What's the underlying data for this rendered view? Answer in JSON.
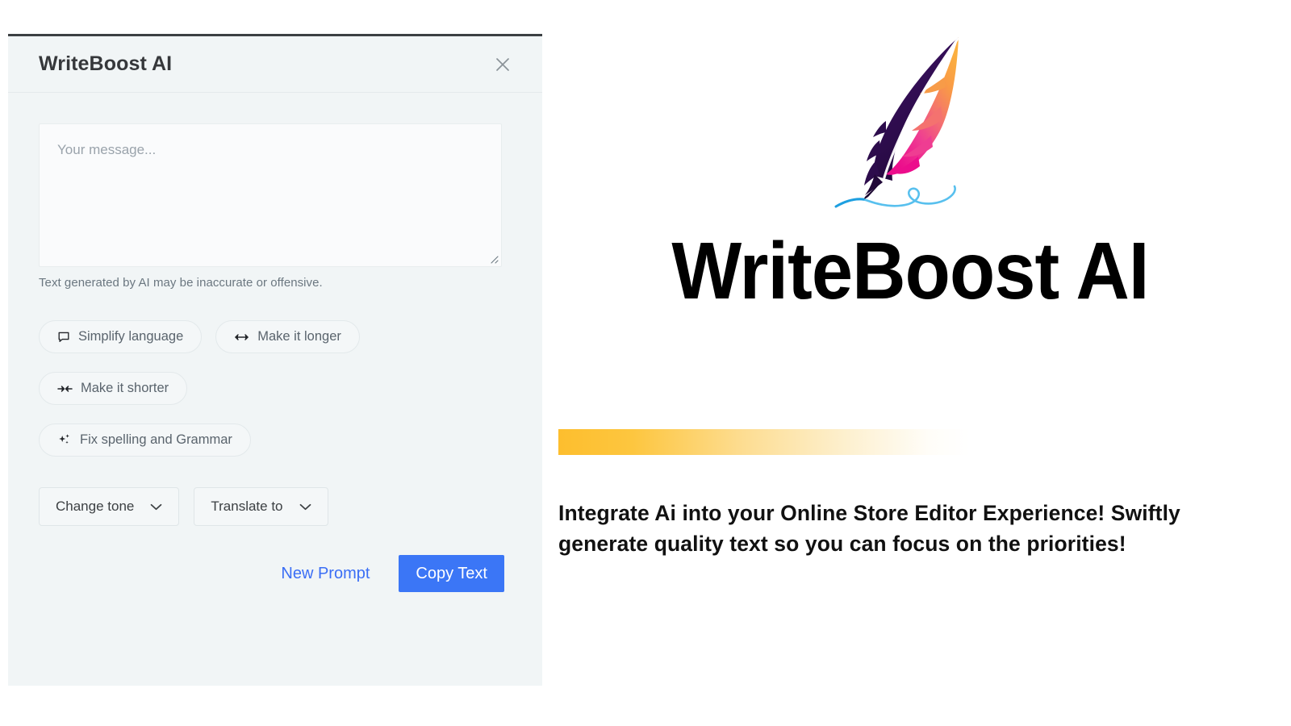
{
  "panel": {
    "title": "WriteBoost AI",
    "close_icon": "close-icon",
    "prompt": {
      "value": "",
      "placeholder": "Your message..."
    },
    "disclaimer": "Text generated by AI may be inaccurate or offensive.",
    "chips": [
      {
        "label": "Simplify language",
        "icon": "speech-bubble-icon"
      },
      {
        "label": "Make it longer",
        "icon": "arrows-expand-icon"
      },
      {
        "label": "Make it shorter",
        "icon": "arrows-collapse-icon"
      },
      {
        "label": "Fix spelling and Grammar",
        "icon": "sparkle-icon"
      }
    ],
    "selects": [
      {
        "label": "Change tone",
        "icon": "chevron-down-icon"
      },
      {
        "label": "Translate to",
        "icon": "chevron-down-icon"
      }
    ],
    "actions": {
      "new_prompt": "New Prompt",
      "copy_text": "Copy Text"
    }
  },
  "brand": {
    "logo_icon": "feather-quill-logo",
    "title": "WriteBoost AI",
    "description": "Integrate Ai into your Online Store Editor Experience! Swiftly generate quality text so you can focus on the priorities!"
  },
  "colors": {
    "panel_background": "#f1f5f6",
    "panel_top_border": "#3c4043",
    "primary_blue": "#3b76f6",
    "link_blue": "#3b6ef5",
    "gradient_start": "#fdbe2e",
    "gradient_end": "#ffffff",
    "feather_dark": "#2b0b45",
    "feather_orange": "#f9a13a",
    "feather_pink": "#f0238c",
    "flourish_blue": "#58c0ee"
  }
}
